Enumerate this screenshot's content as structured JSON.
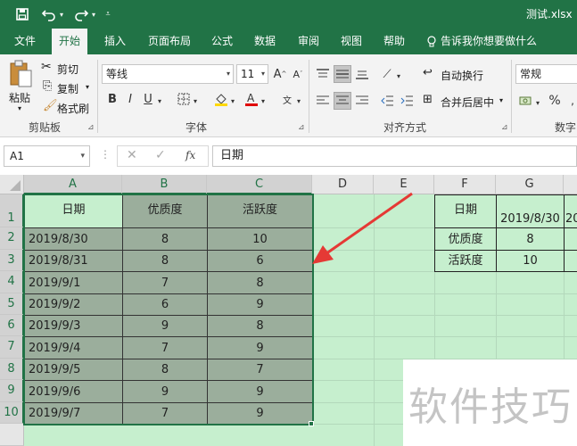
{
  "title_bar": {
    "doc_title": "测试.xlsx",
    "quick_access": [
      "save-icon",
      "undo-icon",
      "redo-icon",
      "customize-icon"
    ]
  },
  "tabs": [
    "文件",
    "开始",
    "插入",
    "页面布局",
    "公式",
    "数据",
    "审阅",
    "视图",
    "帮助"
  ],
  "tell_me": "告诉我你想要做什么",
  "clipboard": {
    "paste": "粘贴",
    "cut": "剪切",
    "copy": "复制",
    "format_painter": "格式刷",
    "group_label": "剪贴板"
  },
  "font": {
    "name": "等线",
    "size": "11",
    "group_label": "字体",
    "bold": "B",
    "italic": "I",
    "underline": "U"
  },
  "alignment": {
    "wrap": "自动换行",
    "merge": "合并后居中",
    "group_label": "对齐方式"
  },
  "number": {
    "format": "常规",
    "percent": "%",
    "group_label": "数字"
  },
  "formula_bar": {
    "name_box": "A1",
    "fx": "fx",
    "value": "日期"
  },
  "columns": [
    "A",
    "B",
    "C",
    "D",
    "E",
    "F",
    "G"
  ],
  "rows": [
    "1",
    "2",
    "3",
    "4",
    "5",
    "6",
    "7",
    "8",
    "9",
    "10"
  ],
  "table": {
    "headers": [
      "日期",
      "优质度",
      "活跃度"
    ],
    "rows": [
      [
        "2019/8/30",
        "8",
        "10"
      ],
      [
        "2019/8/31",
        "8",
        "6"
      ],
      [
        "2019/9/1",
        "7",
        "8"
      ],
      [
        "2019/9/2",
        "6",
        "9"
      ],
      [
        "2019/9/3",
        "9",
        "8"
      ],
      [
        "2019/9/4",
        "7",
        "9"
      ],
      [
        "2019/9/5",
        "8",
        "7"
      ],
      [
        "2019/9/6",
        "9",
        "9"
      ],
      [
        "2019/9/7",
        "7",
        "9"
      ]
    ]
  },
  "transposed": {
    "row1": [
      "日期",
      "2019/8/30",
      "20"
    ],
    "row2": [
      "优质度",
      "8"
    ],
    "row3": [
      "活跃度",
      "10"
    ]
  },
  "watermark": "软件技巧",
  "colors": {
    "excel_green": "#217346",
    "sheet_fill": "#c6efce",
    "selection_fill": "#9bae9c",
    "arrow": "#e53935"
  }
}
